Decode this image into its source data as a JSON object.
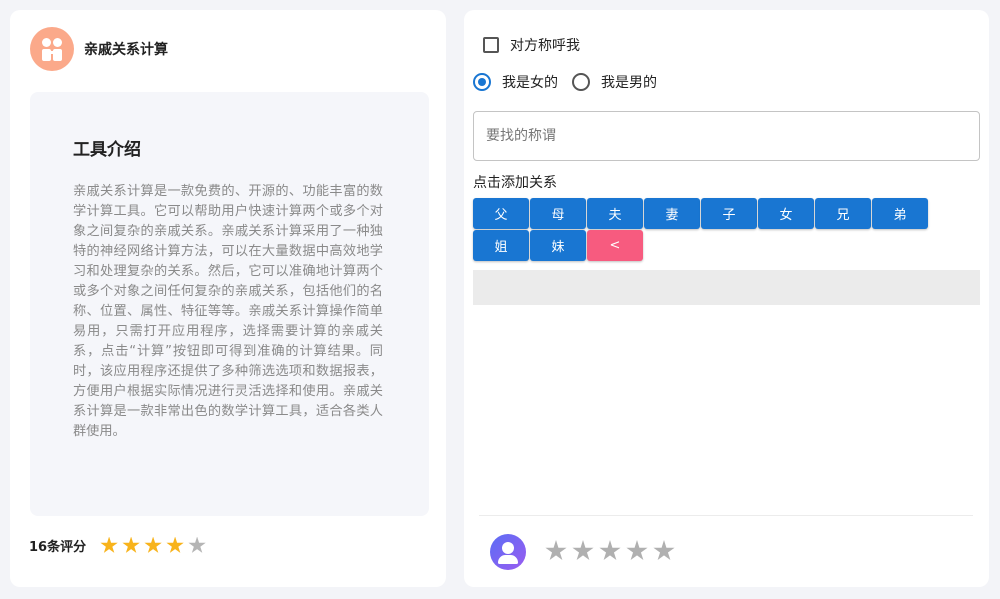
{
  "tool": {
    "title": "亲戚关系计算",
    "logo_icon": "family-icon"
  },
  "intro": {
    "heading": "工具介绍",
    "text": "亲戚关系计算是一款免费的、开源的、功能丰富的数学计算工具。它可以帮助用户快速计算两个或多个对象之间复杂的亲戚关系。亲戚关系计算采用了一种独特的神经网络计算方法，可以在大量数据中高效地学习和处理复杂的关系。然后，它可以准确地计算两个或多个对象之间任何复杂的亲戚关系，包括他们的名称、位置、属性、特征等等。亲戚关系计算操作简单易用，只需打开应用程序，选择需要计算的亲戚关系，点击“计算”按钮即可得到准确的计算结果。同时，该应用程序还提供了多种筛选选项和数据报表，方便用户根据实际情况进行灵活选择和使用。亲戚关系计算是一款非常出色的数学计算工具，适合各类人群使用。"
  },
  "rating_summary": {
    "count_label": "16条评分",
    "stars_filled": 4,
    "stars_total": 5,
    "star_color": "#f8b31b"
  },
  "form": {
    "reverse_call_label": "对方称呼我",
    "reverse_call_checked": false,
    "gender_options": [
      {
        "label": "我是女的",
        "selected": true
      },
      {
        "label": "我是男的",
        "selected": false
      }
    ],
    "search_placeholder": "要找的称谓",
    "search_value": "",
    "add_relation_label": "点击添加关系",
    "relation_buttons": [
      "父",
      "母",
      "夫",
      "妻",
      "子",
      "女",
      "兄",
      "弟",
      "姐",
      "妹"
    ],
    "back_button_label": "<",
    "accent_color": "#1976d2",
    "back_color": "#f75b7f"
  },
  "user_rating": {
    "avatar_icon": "user-avatar-icon",
    "stars_filled": 0,
    "stars_total": 5
  }
}
